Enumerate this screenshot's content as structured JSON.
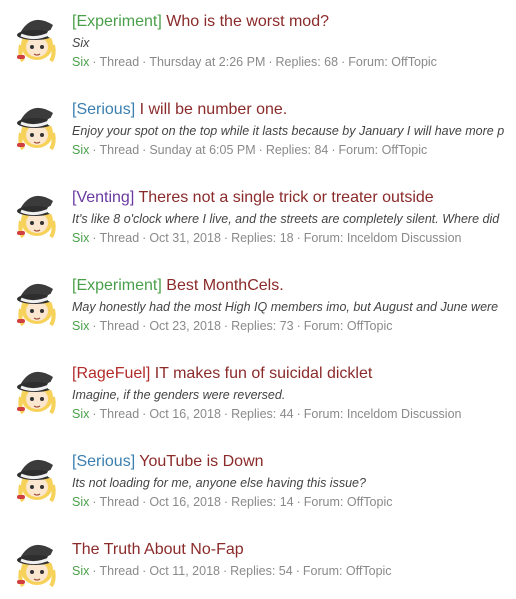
{
  "threads": [
    {
      "prefix": "[Experiment]",
      "prefix_type": "experiment",
      "title": "Who is the worst mod?",
      "snippet": "Six",
      "author": "Six",
      "type": "Thread",
      "date": "Thursday at 2:26 PM",
      "replies": "Replies: 68",
      "forum": "Forum: OffTopic"
    },
    {
      "prefix": "[Serious]",
      "prefix_type": "serious",
      "title": "I will be number one.",
      "snippet": "Enjoy your spot on the top while it lasts because by January I will have more p",
      "author": "Six",
      "type": "Thread",
      "date": "Sunday at 6:05 PM",
      "replies": "Replies: 84",
      "forum": "Forum: OffTopic"
    },
    {
      "prefix": "[Venting]",
      "prefix_type": "venting",
      "title": "Theres not a single trick or treater outside",
      "snippet": "It's like 8 o'clock where I live, and the streets are completely silent. Where did",
      "author": "Six",
      "type": "Thread",
      "date": "Oct 31, 2018",
      "replies": "Replies: 18",
      "forum": "Forum: Inceldom Discussion"
    },
    {
      "prefix": "[Experiment]",
      "prefix_type": "experiment",
      "title": "Best MonthCels.",
      "snippet": "May honestly had the most High IQ members imo, but August and June were",
      "author": "Six",
      "type": "Thread",
      "date": "Oct 23, 2018",
      "replies": "Replies: 73",
      "forum": "Forum: OffTopic"
    },
    {
      "prefix": "[RageFuel]",
      "prefix_type": "ragefuel",
      "title": "IT makes fun of suicidal dicklet",
      "snippet": "Imagine, if the genders were reversed.",
      "author": "Six",
      "type": "Thread",
      "date": "Oct 16, 2018",
      "replies": "Replies: 44",
      "forum": "Forum: Inceldom Discussion"
    },
    {
      "prefix": "[Serious]",
      "prefix_type": "serious",
      "title": "YouTube is Down",
      "snippet": "Its not loading for me, anyone else having this issue?",
      "author": "Six",
      "type": "Thread",
      "date": "Oct 16, 2018",
      "replies": "Replies: 14",
      "forum": "Forum: OffTopic"
    },
    {
      "prefix": "",
      "prefix_type": "",
      "title": "The Truth About No-Fap",
      "snippet": "",
      "author": "Six",
      "type": "Thread",
      "date": "Oct 11, 2018",
      "replies": "Replies: 54",
      "forum": "Forum: OffTopic"
    }
  ],
  "separator": "·",
  "avatar_icon": "witch-hat-avatar-icon"
}
